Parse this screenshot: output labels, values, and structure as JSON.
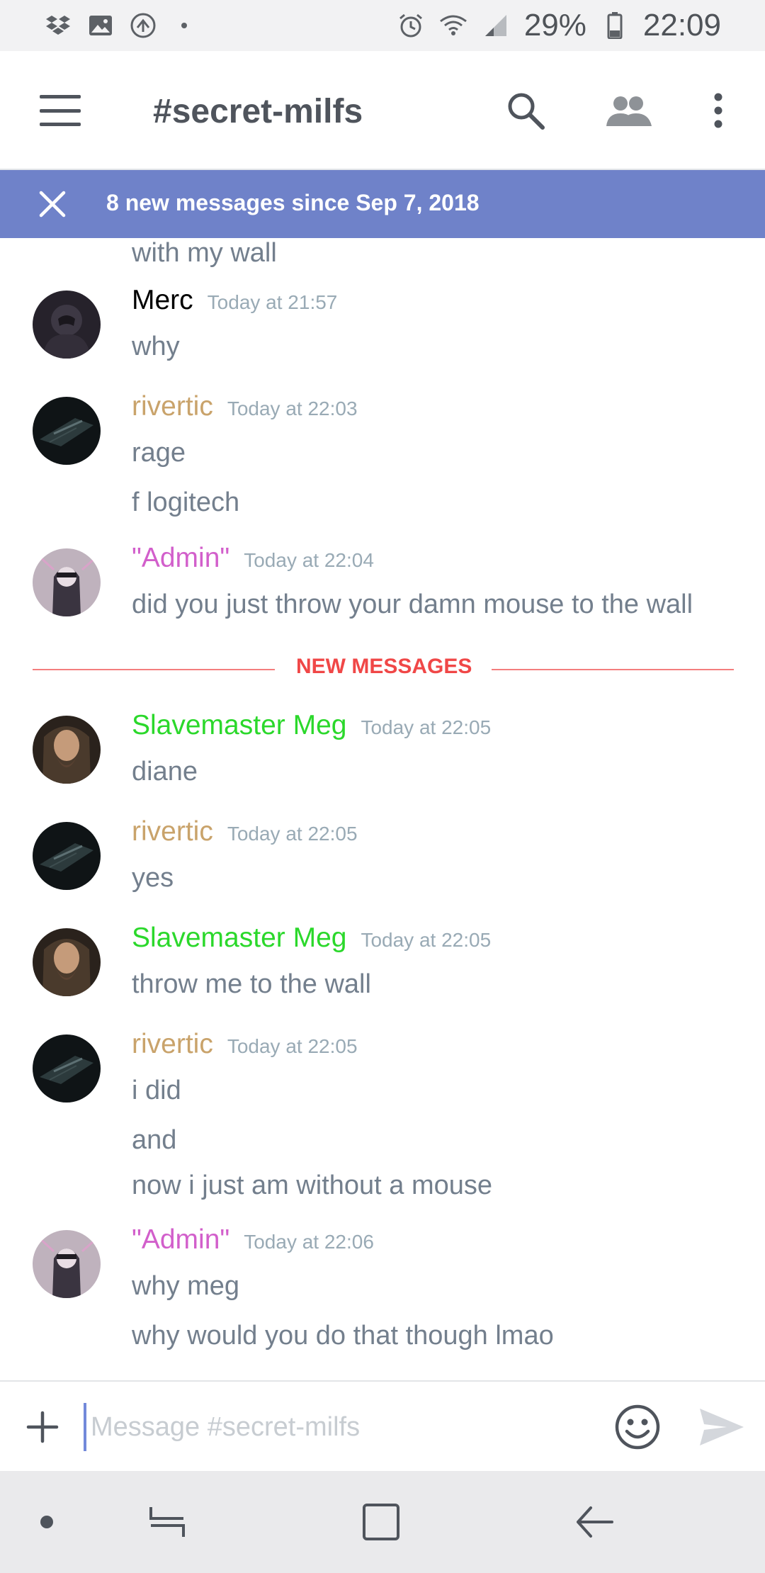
{
  "status_bar": {
    "battery_percent": "29%",
    "time": "22:09",
    "left_icons": [
      "dropbox-icon",
      "gallery-icon",
      "sync-icon",
      "dot-icon"
    ],
    "right_icons": [
      "alarm-icon",
      "wifi-icon",
      "signal-icon",
      "battery-icon"
    ]
  },
  "app_bar": {
    "channel_name": "#secret-milfs",
    "icons": [
      "menu-icon",
      "search-icon",
      "members-icon",
      "more-vertical-icon"
    ]
  },
  "new_messages_bar": {
    "text": "8 new messages since Sep 7, 2018",
    "close_icon": "close-icon"
  },
  "colors": {
    "accent": "#7289da",
    "banner": "#6f82c9",
    "new_messages_red": "#f04747",
    "author_merc": "#000000",
    "author_rivertic": "#c9a36b",
    "author_admin": "#d25fcb",
    "author_meg": "#2bd82b",
    "message_text": "#737f8d",
    "timestamp": "#99aab5"
  },
  "messages": {
    "partial_line": "with my wall",
    "groups": [
      {
        "author": "Merc",
        "timestamp": "Today at 21:57",
        "lines": [
          "why"
        ]
      },
      {
        "author": "rivertic",
        "timestamp": "Today at 22:03",
        "lines": [
          "rage",
          "f logitech"
        ]
      },
      {
        "author": "\"Admin\"",
        "timestamp": "Today at 22:04",
        "lines": [
          "did you just throw your damn mouse to the wall"
        ]
      },
      {
        "author": "Slavemaster Meg",
        "timestamp": "Today at 22:05",
        "lines": [
          "diane"
        ]
      },
      {
        "author": "rivertic",
        "timestamp": "Today at 22:05",
        "lines": [
          "yes"
        ]
      },
      {
        "author": "Slavemaster Meg",
        "timestamp": "Today at 22:05",
        "lines": [
          "throw me to the wall"
        ]
      },
      {
        "author": "rivertic",
        "timestamp": "Today at 22:05",
        "lines": [
          "i did",
          "and",
          "now i just am without a mouse"
        ]
      },
      {
        "author": "\"Admin\"",
        "timestamp": "Today at 22:06",
        "lines": [
          "why meg",
          "why would you do that though lmao"
        ]
      }
    ],
    "divider_label": "NEW MESSAGES"
  },
  "input_bar": {
    "placeholder": "Message #secret-milfs",
    "value": "",
    "icons": [
      "plus-icon",
      "emoji-icon",
      "send-icon"
    ]
  },
  "nav_bar": {
    "icons": [
      "dot-icon",
      "recents-icon",
      "home-icon",
      "back-icon"
    ]
  }
}
